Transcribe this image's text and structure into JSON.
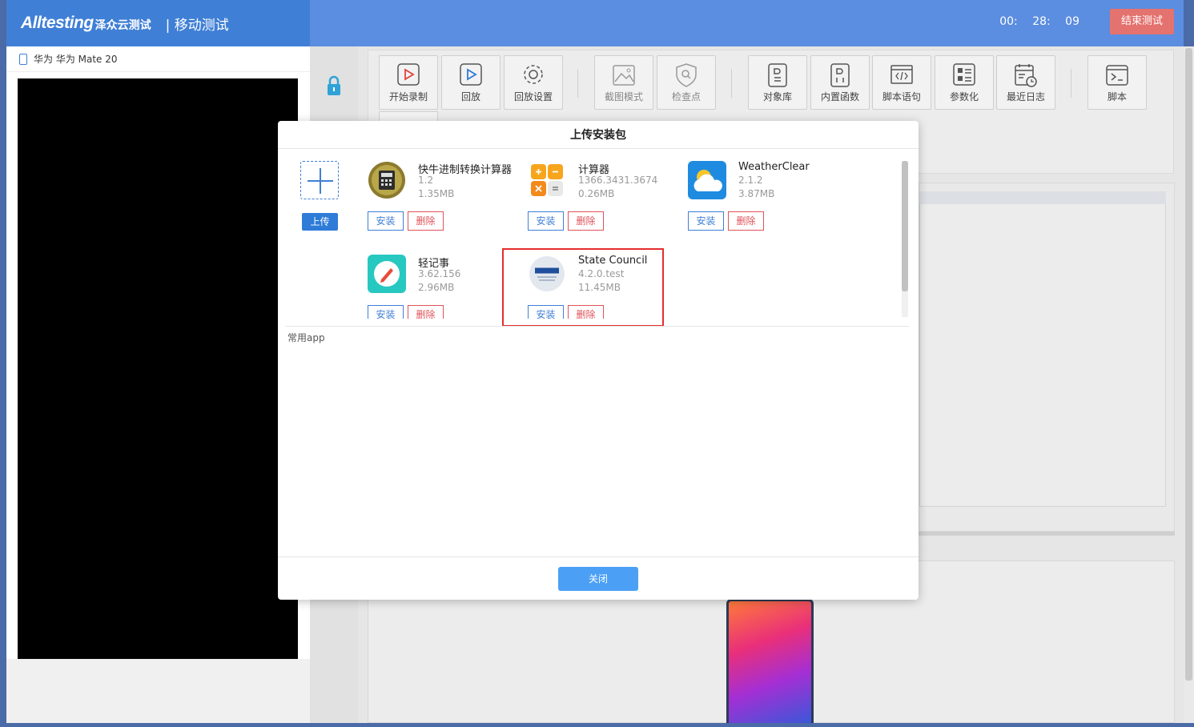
{
  "header": {
    "logo_text": "Alltesting",
    "logo_cn": "泽众云测试",
    "section_title": "| 移动测试",
    "timer": "00:   28:   09",
    "end_button": "结束测试"
  },
  "device": {
    "title": "华为 华为 Mate 20"
  },
  "toolbar": {
    "items": [
      {
        "label": "开始录制"
      },
      {
        "label": "回放"
      },
      {
        "label": "回放设置"
      },
      {
        "label": "截图模式"
      },
      {
        "label": "检查点"
      },
      {
        "label": "对象库"
      },
      {
        "label": "内置函数"
      },
      {
        "label": "脚本语句"
      },
      {
        "label": "参数化"
      },
      {
        "label": "最近日志"
      },
      {
        "label": "脚本"
      }
    ]
  },
  "modal": {
    "title": "上传安装包",
    "upload_label": "上传",
    "install_label": "安装",
    "delete_label": "删除",
    "common_label": "常用app",
    "close_label": "关闭",
    "packages": [
      {
        "name": "快牛进制转换计算器",
        "version": "1.2",
        "size": "1.35MB",
        "icon": "calculator-icon"
      },
      {
        "name": "计算器",
        "version": "1366.3431.3674",
        "size": "0.26MB",
        "icon": "calculator-grid-icon"
      },
      {
        "name": "WeatherClear",
        "version": "2.1.2",
        "size": "3.87MB",
        "icon": "weather-icon"
      },
      {
        "name": "轻记事",
        "version": "3.62.156",
        "size": "2.96MB",
        "icon": "note-pencil-icon"
      },
      {
        "name": "State Council",
        "version": "4.2.0.test",
        "size": "11.45MB",
        "icon": "state-council-icon"
      }
    ]
  },
  "colors": {
    "header_left": "#3f7fd6",
    "header_right": "#5b8de0",
    "end_button": "#e4726f",
    "install": "#3f7fd6",
    "delete": "#e0525a",
    "highlight": "#e42e2e",
    "close_button": "#4ba0f5"
  }
}
